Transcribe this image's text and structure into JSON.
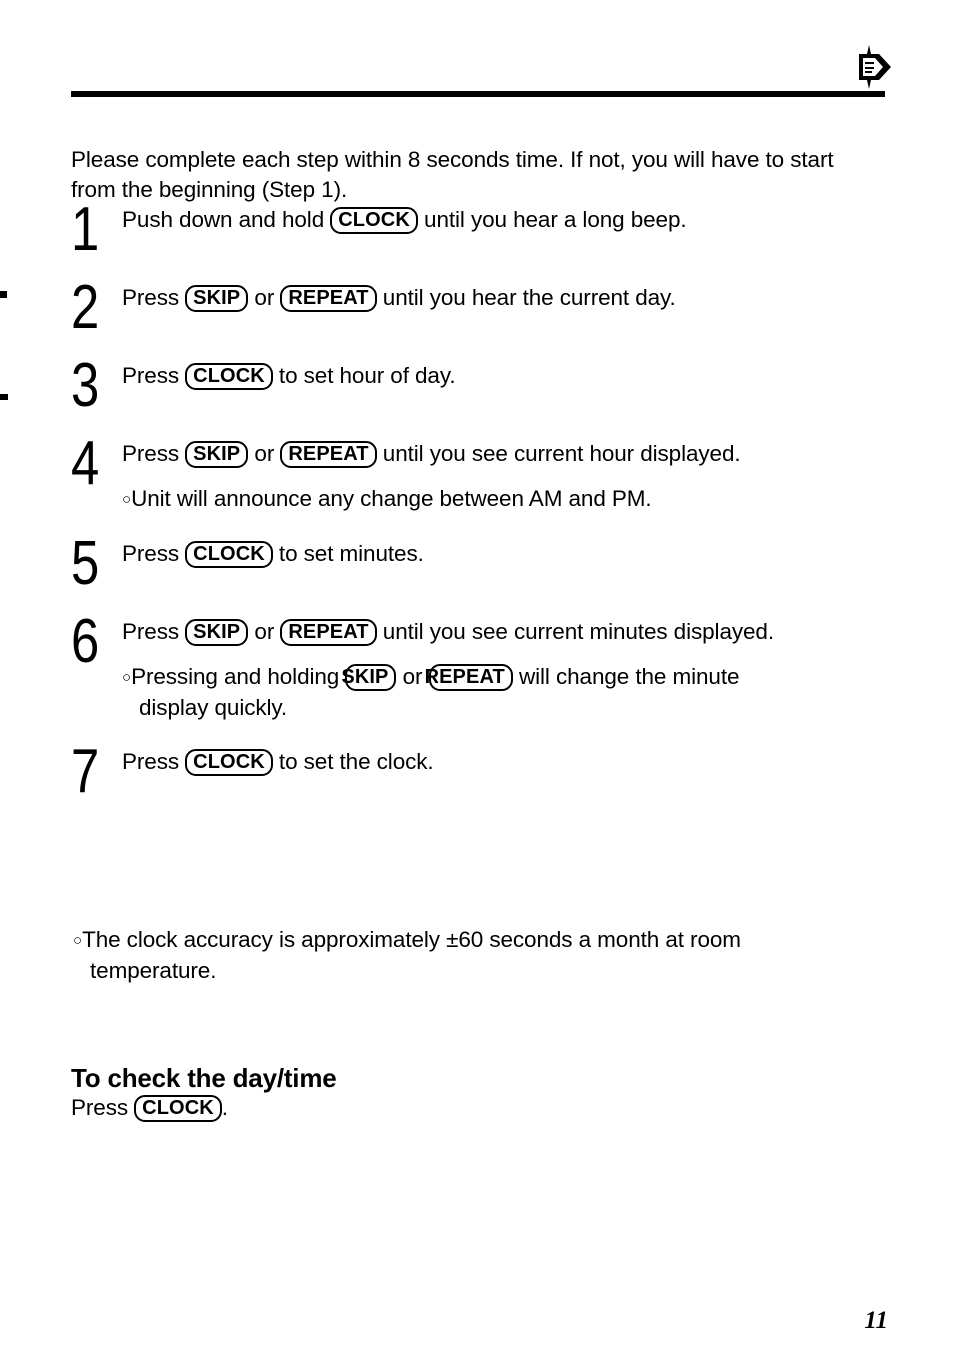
{
  "header": {
    "corner_icon": "pointing-hand-icon"
  },
  "intro": {
    "text": "Please complete each step within 8 seconds time. If not, you will have to start from the beginning (Step 1)."
  },
  "keys": {
    "clock": "CLOCK",
    "skip": "SKIP",
    "repeat": "REPEAT"
  },
  "steps": [
    {
      "number": "1",
      "pre": "Push down and hold ",
      "key1": "CLOCK",
      "mid": "",
      "key2": "",
      "post": " until you hear a long beep.",
      "note": "",
      "note_key1": "",
      "note_mid": "",
      "note_key2": "",
      "note_post": "",
      "note_cont": ""
    },
    {
      "number": "2",
      "pre": "Press ",
      "key1": "SKIP",
      "mid": " or ",
      "key2": "REPEAT",
      "post": " until you hear the current day.",
      "note": "",
      "note_key1": "",
      "note_mid": "",
      "note_key2": "",
      "note_post": "",
      "note_cont": ""
    },
    {
      "number": "3",
      "pre": "Press ",
      "key1": "CLOCK",
      "mid": "",
      "key2": "",
      "post": " to set hour of day.",
      "note": "",
      "note_key1": "",
      "note_mid": "",
      "note_key2": "",
      "note_post": "",
      "note_cont": ""
    },
    {
      "number": "4",
      "pre": "Press ",
      "key1": "SKIP",
      "mid": " or ",
      "key2": "REPEAT",
      "post": " until you see current hour displayed.",
      "note": "Unit will announce any change between AM and PM.",
      "note_key1": "",
      "note_mid": "",
      "note_key2": "",
      "note_post": "",
      "note_cont": ""
    },
    {
      "number": "5",
      "pre": "Press ",
      "key1": "CLOCK",
      "mid": "",
      "key2": "",
      "post": " to set minutes.",
      "note": "",
      "note_key1": "",
      "note_mid": "",
      "note_key2": "",
      "note_post": "",
      "note_cont": ""
    },
    {
      "number": "6",
      "pre": "Press ",
      "key1": "SKIP",
      "mid": " or ",
      "key2": "REPEAT",
      "post": " until you see current minutes displayed.",
      "note": "Pressing and holding ",
      "note_key1": "SKIP",
      "note_mid": " or ",
      "note_key2": "REPEAT",
      "note_post": " will change the minute",
      "note_cont": "display quickly."
    },
    {
      "number": "7",
      "pre": "Press ",
      "key1": "CLOCK",
      "mid": "",
      "key2": "",
      "post": " to set the clock.",
      "note": "",
      "note_key1": "",
      "note_mid": "",
      "note_key2": "",
      "note_post": "",
      "note_cont": ""
    }
  ],
  "tail_note": {
    "text": "The clock accuracy is approximately ±60 seconds a month at room",
    "continuation": "temperature."
  },
  "section": {
    "heading": "To check the day/time",
    "pre": "Press ",
    "key": "CLOCK",
    "post": "."
  },
  "footer": {
    "page_number": "11"
  }
}
